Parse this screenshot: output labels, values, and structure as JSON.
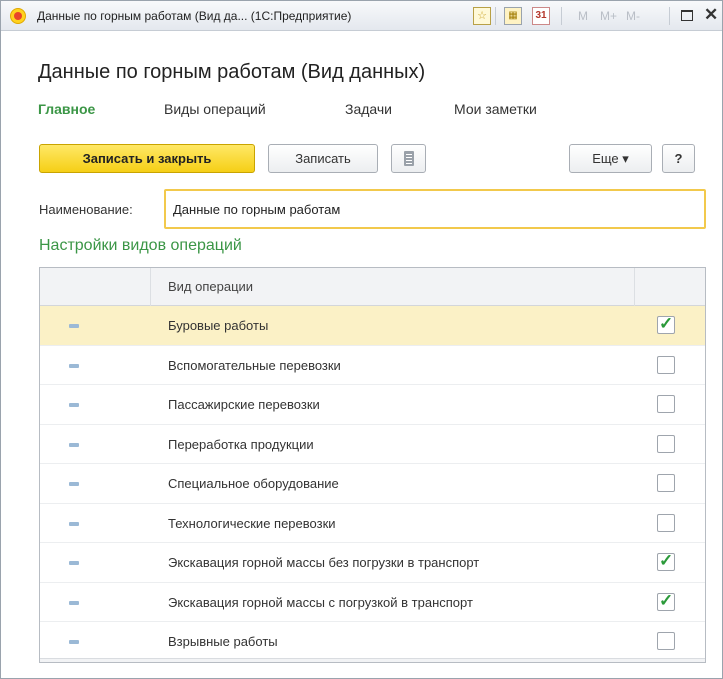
{
  "window": {
    "title": "Данные по горным работам (Вид да... (1С:Предприятие)",
    "m_buttons": [
      "M",
      "M+",
      "M-"
    ]
  },
  "page": {
    "title": "Данные по горным работам (Вид данных)"
  },
  "nav": {
    "items": [
      {
        "label": "Главное",
        "active": true
      },
      {
        "label": "Виды операций",
        "active": false
      },
      {
        "label": "Задачи",
        "active": false
      },
      {
        "label": "Мои заметки",
        "active": false
      }
    ]
  },
  "toolbar": {
    "save_close_label": "Записать и закрыть",
    "save_label": "Записать",
    "more_label": "Еще ▾",
    "help_label": "?"
  },
  "form": {
    "name_label": "Наименование:",
    "name_value": "Данные по горным работам"
  },
  "section": {
    "title": "Настройки видов операций"
  },
  "table": {
    "header": "Вид операции",
    "rows": [
      {
        "label": "Буровые работы",
        "checked": true,
        "selected": true
      },
      {
        "label": "Вспомогательные перевозки",
        "checked": false,
        "selected": false
      },
      {
        "label": "Пассажирские перевозки",
        "checked": false,
        "selected": false
      },
      {
        "label": "Переработка продукции",
        "checked": false,
        "selected": false
      },
      {
        "label": "Специальное оборудование",
        "checked": false,
        "selected": false
      },
      {
        "label": "Технологические перевозки",
        "checked": false,
        "selected": false
      },
      {
        "label": "Экскавация горной массы без погрузки в транспорт",
        "checked": true,
        "selected": false
      },
      {
        "label": "Экскавация горной массы с погрузкой в транспорт",
        "checked": true,
        "selected": false
      },
      {
        "label": "Взрывные работы",
        "checked": false,
        "selected": false
      }
    ]
  },
  "colors": {
    "accent_green": "#3b9646",
    "primary_button": "#f5cf16",
    "selected_row": "#fbf1c6",
    "input_focus_border": "#f2c94c"
  },
  "icons": {
    "app": "1c-logo-icon",
    "favorite": "star-icon",
    "table_view": "grid-icon",
    "calendar": "calendar-icon",
    "document": "document-list-icon",
    "maximize": "maximize-icon",
    "close": "close-icon",
    "row_marker": "row-marker-icon",
    "check": "checkmark-icon"
  }
}
